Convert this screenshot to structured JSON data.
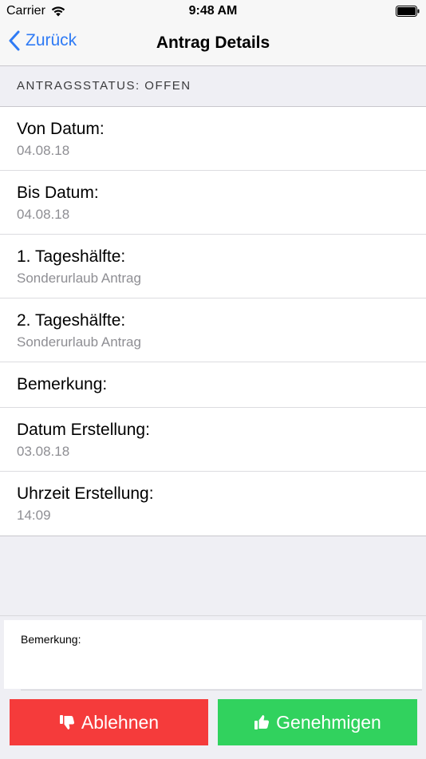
{
  "status_bar": {
    "carrier": "Carrier",
    "time": "9:48 AM"
  },
  "nav": {
    "back_label": "Zurück",
    "title": "Antrag Details"
  },
  "section": {
    "header": "ANTRAGSSTATUS: OFFEN"
  },
  "details": [
    {
      "label": "Von Datum:",
      "value": "04.08.18"
    },
    {
      "label": "Bis Datum:",
      "value": "04.08.18"
    },
    {
      "label": "1. Tageshälfte:",
      "value": "Sonderurlaub Antrag"
    },
    {
      "label": "2. Tageshälfte:",
      "value": "Sonderurlaub Antrag"
    },
    {
      "label": "Bemerkung:",
      "value": ""
    },
    {
      "label": "Datum Erstellung:",
      "value": "03.08.18"
    },
    {
      "label": "Uhrzeit Erstellung:",
      "value": "14:09"
    }
  ],
  "comment": {
    "label": "Bemerkung:"
  },
  "actions": {
    "reject_label": "Ablehnen",
    "approve_label": "Genehmigen"
  },
  "colors": {
    "accent": "#2f7bf5",
    "reject": "#f53b3b",
    "approve": "#31d25e"
  },
  "icons": {
    "reject": "thumbs-down-icon",
    "approve": "thumbs-up-icon",
    "back": "chevron-left-icon",
    "wifi": "wifi-icon",
    "battery": "battery-icon"
  }
}
